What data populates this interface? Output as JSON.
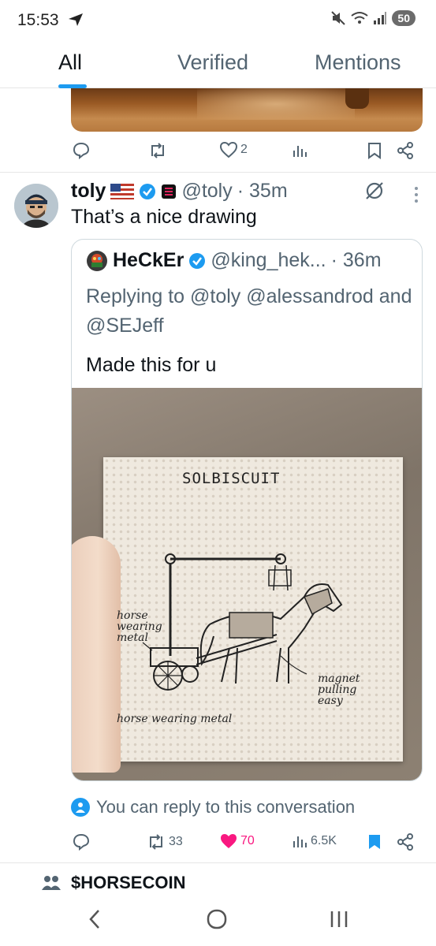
{
  "status_bar": {
    "time": "15:53",
    "battery": "50"
  },
  "tabs": [
    {
      "label": "All",
      "active": true
    },
    {
      "label": "Verified",
      "active": false
    },
    {
      "label": "Mentions",
      "active": false
    }
  ],
  "prev_tweet": {
    "like_count": "2",
    "icons": [
      "reply-icon",
      "retweet-icon",
      "like-icon",
      "views-icon",
      "bookmark-icon",
      "share-icon"
    ]
  },
  "tweet": {
    "name": "toly",
    "handle": "@toly",
    "time": "· 35m",
    "text": "That’s a nice drawing",
    "quote": {
      "name": "HeCkEr",
      "handle": "@king_hek...",
      "time": "· 36m",
      "replying_to": "Replying to @toly @alessandrod and @SEJeff",
      "text": "Made this for u",
      "image": {
        "title": "SOLBISCUIT",
        "label_left": "horse wearing metal",
        "label_bottom": "horse wearing metal",
        "label_right": "magnet pulling easy"
      }
    },
    "reply_notice": "You can reply to this conversation",
    "stats": {
      "retweets": "33",
      "likes": "70",
      "views": "6.5K"
    },
    "colors": {
      "like": "#f91880",
      "accent": "#1d9bf0"
    }
  },
  "topic": {
    "label": "$HORSECOIN"
  }
}
